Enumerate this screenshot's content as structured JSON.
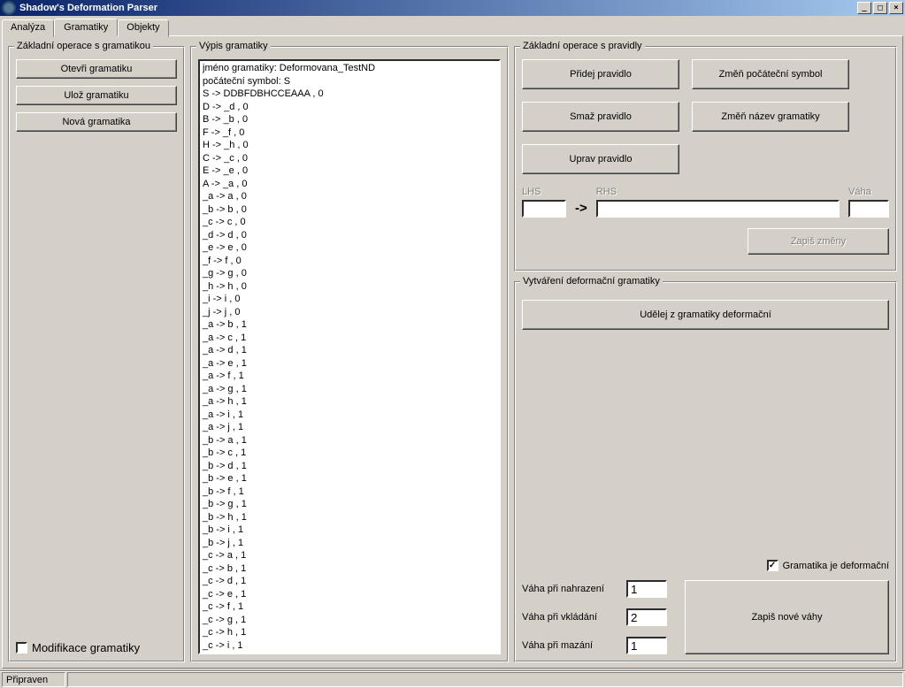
{
  "window": {
    "title": "Shadow's Deformation Parser"
  },
  "tabs": [
    {
      "label": "Analýza"
    },
    {
      "label": "Gramatiky"
    },
    {
      "label": "Objekty"
    }
  ],
  "active_tab": 1,
  "left_panel": {
    "title": "Základní operace s gramatikou",
    "open_btn": "Otevři gramatiku",
    "save_btn": "Ulož gramatiku",
    "new_btn": "Nová gramatika",
    "modify_checkbox_label": "Modifikace gramatiky",
    "modify_checked": false
  },
  "listing": {
    "title": "Výpis gramatiky",
    "lines": [
      "jméno gramatiky: Deformovana_TestND",
      "počáteční symbol: S",
      "S -> DDBFDBHCCEAAA , 0",
      "D -> _d , 0",
      "B -> _b , 0",
      "F -> _f , 0",
      "H -> _h , 0",
      "C -> _c , 0",
      "E -> _e , 0",
      "A -> _a , 0",
      "_a -> a , 0",
      "_b -> b , 0",
      "_c -> c , 0",
      "_d -> d , 0",
      "_e -> e , 0",
      "_f -> f , 0",
      "_g -> g , 0",
      "_h -> h , 0",
      "_i -> i , 0",
      "_j -> j , 0",
      "_a -> b , 1",
      "_a -> c , 1",
      "_a -> d , 1",
      "_a -> e , 1",
      "_a -> f , 1",
      "_a -> g , 1",
      "_a -> h , 1",
      "_a -> i , 1",
      "_a -> j , 1",
      "_b -> a , 1",
      "_b -> c , 1",
      "_b -> d , 1",
      "_b -> e , 1",
      "_b -> f , 1",
      "_b -> g , 1",
      "_b -> h , 1",
      "_b -> i , 1",
      "_b -> j , 1",
      "_c -> a , 1",
      "_c -> b , 1",
      "_c -> d , 1",
      "_c -> e , 1",
      "_c -> f , 1",
      "_c -> g , 1",
      "_c -> h , 1",
      "_c -> i , 1"
    ]
  },
  "rules_panel": {
    "title": "Základní operace s pravidly",
    "add_btn": "Přidej pravidlo",
    "change_start_btn": "Změň počáteční symbol",
    "delete_btn": "Smaž pravidlo",
    "rename_btn": "Změň název gramatiky",
    "edit_btn": "Uprav pravidlo",
    "lhs_label": "LHS",
    "rhs_label": "RHS",
    "weight_label": "Váha",
    "lhs_value": "",
    "rhs_value": "",
    "weight_value": "",
    "arrow": "->",
    "apply_btn": "Zapiš změny"
  },
  "deform_panel": {
    "title": "Vytváření deformační gramatiky",
    "make_btn": "Udělej z gramatiky deformační",
    "is_deform_label": "Gramatika je deformační",
    "is_deform_checked": true,
    "weight_replace_label": "Váha při nahrazení",
    "weight_insert_label": "Váha při vkládání",
    "weight_delete_label": "Váha při mazání",
    "weight_replace_value": "1",
    "weight_insert_value": "2",
    "weight_delete_value": "1",
    "save_weights_btn": "Zapiš nové váhy"
  },
  "statusbar": {
    "text": "Připraven"
  }
}
